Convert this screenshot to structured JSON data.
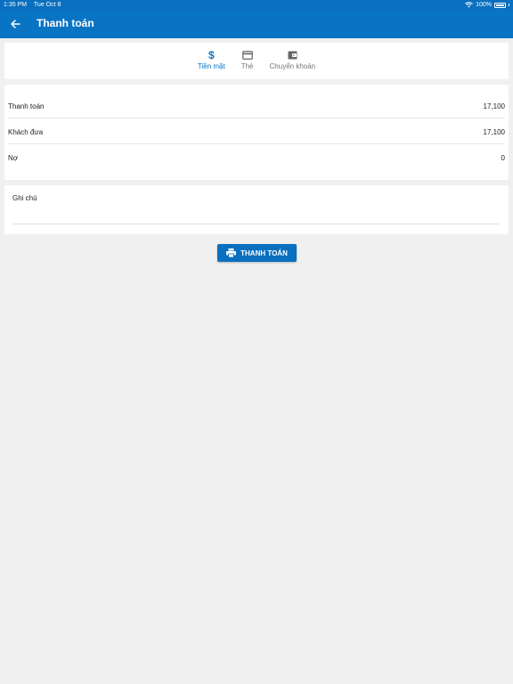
{
  "status_bar": {
    "time": "1:35 PM",
    "date": "Tue Oct 8",
    "battery": "100%"
  },
  "app_bar": {
    "title": "Thanh toán"
  },
  "payment_tabs": [
    {
      "label": "Tiền mặt",
      "icon": "dollar-icon",
      "active": true
    },
    {
      "label": "Thẻ",
      "icon": "credit-card-icon",
      "active": false
    },
    {
      "label": "Chuyển khoản",
      "icon": "wallet-icon",
      "active": false
    }
  ],
  "summary": {
    "payment_label": "Thanh toán",
    "payment_value": "17,100",
    "customer_paid_label": "Khách đưa",
    "customer_paid_value": "17,100",
    "debt_label": "Nợ",
    "debt_value": "0"
  },
  "note": {
    "label": "Ghi chú",
    "value": ""
  },
  "pay_button": {
    "label": "THANH TOÁN",
    "icon": "printer-icon"
  },
  "colors": {
    "primary": "#0a74c4",
    "background": "#f0f0f0"
  }
}
